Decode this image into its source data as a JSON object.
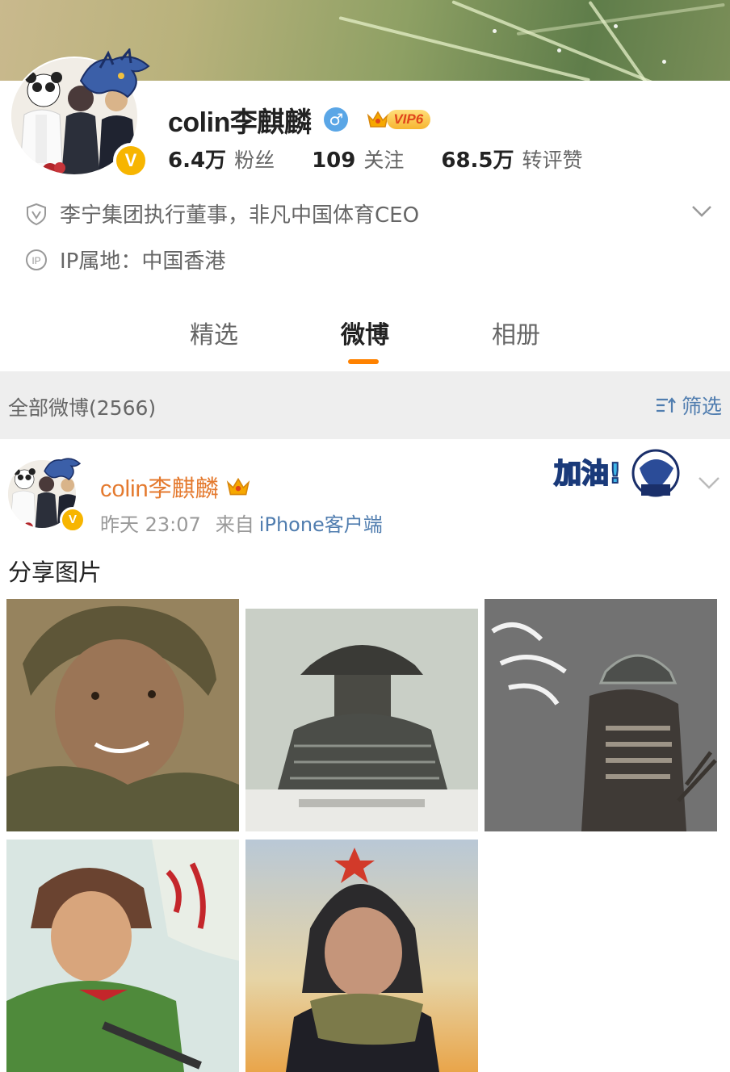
{
  "profile": {
    "username": "colin李麒麟",
    "vip_label": "VIP6",
    "verified_mark": "V",
    "stats": [
      {
        "num": "6.4万",
        "label": "粉丝"
      },
      {
        "num": "109",
        "label": "关注"
      },
      {
        "num": "68.5万",
        "label": "转评赞"
      }
    ],
    "description": "李宁集团执行董事，非凡中国体育CEO",
    "ip_location": "IP属地：中国香港",
    "icons": {
      "gender": "male-icon",
      "verified": "shield-v-icon",
      "ip": "ip-icon",
      "expand": "chevron-down-icon"
    }
  },
  "tabs": [
    {
      "label": "精选"
    },
    {
      "label": "微博"
    },
    {
      "label": "相册"
    }
  ],
  "active_tab": "微博",
  "filter_bar": {
    "title": "全部微博(2566)",
    "filter_label": "筛选"
  },
  "post": {
    "username": "colin李麒麟",
    "time": "昨天 23:07",
    "source_prefix": "来自",
    "source": "iPhone客户端",
    "text": "分享图片",
    "sticker_text": "加油!",
    "photo_count": 5
  },
  "colors": {
    "accent_orange": "#ff8200",
    "link_blue": "#507daf",
    "username_orange": "#e47a2f",
    "verified_gold": "#f7b500"
  }
}
